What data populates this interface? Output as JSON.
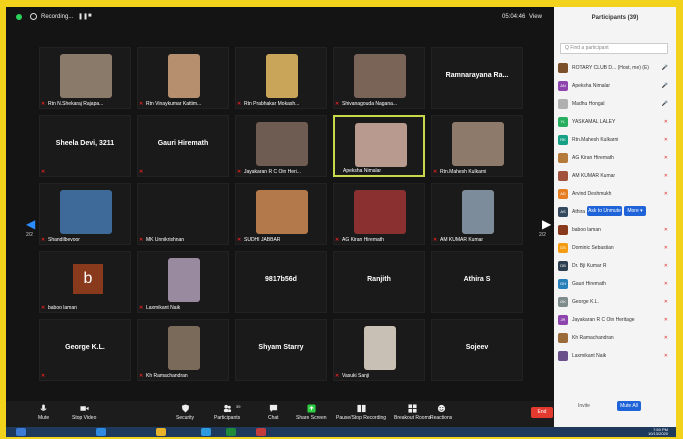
{
  "topbar": {
    "recording": "Recording...",
    "pause": "❚❚",
    "stop": "■",
    "clock": "05:04:46",
    "view": "View"
  },
  "nav": {
    "left_page": "2/2",
    "right_page": "2/2"
  },
  "tiles": [
    {
      "name": "Rtn N.Shekaraj Rajapa...",
      "center": ""
    },
    {
      "name": "Rtn Vinaykumar Kattim...",
      "center": ""
    },
    {
      "name": "Rtn Prabhakar Mokash...",
      "center": ""
    },
    {
      "name": "Shivanagouda Nagana...",
      "center": ""
    },
    {
      "name": "",
      "center": "Ramnarayana Ra..."
    },
    {
      "name": "",
      "center": "Sheela Devi, 3211"
    },
    {
      "name": "",
      "center": "Gauri Hiremath"
    },
    {
      "name": "Jayakaran R C Oin Heri...",
      "center": ""
    },
    {
      "name": "Apeksha Nimalar",
      "center": ""
    },
    {
      "name": "Rtn.Mahesh Kulkarni",
      "center": ""
    },
    {
      "name": "Shandilbevoor",
      "center": ""
    },
    {
      "name": "MK Unnikrishnan",
      "center": ""
    },
    {
      "name": "SUDHI JABBAR",
      "center": ""
    },
    {
      "name": "AG Kiran Hiremath",
      "center": ""
    },
    {
      "name": "AM KUMAR Kumar",
      "center": ""
    },
    {
      "name": "baboo laman",
      "center": "",
      "avatar": "b"
    },
    {
      "name": "Laxmikant Naik",
      "center": ""
    },
    {
      "name": "",
      "center": "9817b56d"
    },
    {
      "name": "",
      "center": "Ranjith"
    },
    {
      "name": "",
      "center": "Athira S"
    },
    {
      "name": "",
      "center": "George K.L."
    },
    {
      "name": "Kh Ramachandran",
      "center": ""
    },
    {
      "name": "",
      "center": "Shyam Starry"
    },
    {
      "name": "Vasuki Sanji",
      "center": ""
    },
    {
      "name": "",
      "center": "Sojeev"
    }
  ],
  "toolbar": {
    "mute": "Mute",
    "stop_video": "Stop Video",
    "security": "Security",
    "participants": "Participants",
    "participants_count": "39",
    "chat": "Chat",
    "share": "Share Screen",
    "pause_rec": "Pause/Stop Recording",
    "breakout": "Breakout Rooms",
    "reactions": "Reactions",
    "end": "End"
  },
  "panel": {
    "title": "Participants (39)",
    "search_placeholder": "Q Find a participant",
    "participants": [
      {
        "initials": "",
        "name": "ROTARY CLUB D... (Host, me) (E)",
        "color": "#7a4f2a"
      },
      {
        "initials": "AN",
        "name": "Apeksha Nimalar",
        "color": "#8e44ad"
      },
      {
        "initials": "",
        "name": "Madhu Hongal",
        "color": "#b0b0b0"
      },
      {
        "initials": "YL",
        "name": "YASKAMAL LALEY",
        "color": "#27ae60"
      },
      {
        "initials": "RK",
        "name": "Rtn.Mahesh Kulkarni",
        "color": "#16a085"
      },
      {
        "initials": "",
        "name": "AG Kiran Hiremath",
        "color": "#b57a3a"
      },
      {
        "initials": "",
        "name": "AM KUMAR Kumar",
        "color": "#a0523a"
      },
      {
        "initials": "AD",
        "name": "Arvind Deshmukh",
        "color": "#e67e22"
      },
      {
        "initials": "AS",
        "name": "Athira S",
        "color": "#34495e"
      },
      {
        "initials": "",
        "name": "baboo laman",
        "color": "#8a3a1c"
      },
      {
        "initials": "DS",
        "name": "Dominic Sebastian",
        "color": "#f39c12"
      },
      {
        "initials": "DB",
        "name": "Dr. Bji Kumar R",
        "color": "#2c3e50"
      },
      {
        "initials": "GH",
        "name": "Gauri Hiremath",
        "color": "#2980b9"
      },
      {
        "initials": "GK",
        "name": "George K.L.",
        "color": "#7f8c8d"
      },
      {
        "initials": "JR",
        "name": "Jayakaran R C Oin Heritage",
        "color": "#8e44ad"
      },
      {
        "initials": "",
        "name": "Kh Ramachandran",
        "color": "#9b6b3a"
      },
      {
        "initials": "",
        "name": "Laxmikant Naik",
        "color": "#6b4f8a"
      }
    ],
    "unmute": "Ask to Unmute",
    "more": "More ▾",
    "invite": "Invite",
    "mute_all": "Mute All"
  },
  "tray": {
    "time": "7:50 PM",
    "date": "10/13/2020"
  }
}
